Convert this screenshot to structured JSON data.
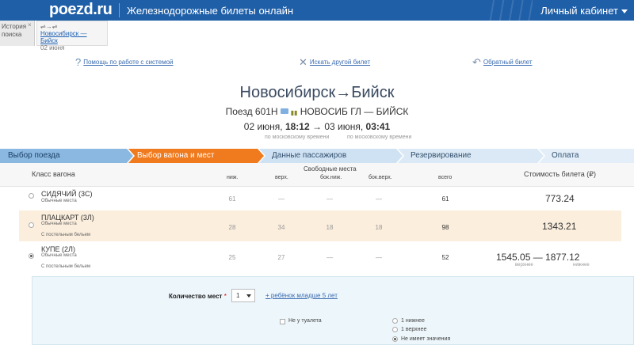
{
  "header": {
    "logo": "poezd.ru",
    "tagline": "Железнодорожные билеты онлайн",
    "cabinet": "Личный кабинет"
  },
  "history": {
    "label_line1": "История",
    "label_line2": "поиска",
    "close": "×",
    "icons": "⇌→⇌",
    "route": "Новосибирск — Бийск",
    "date": "02 июня"
  },
  "links": {
    "help": "Помощь по работе с системой",
    "other": "Искать другой билет",
    "return": "Обратный билет"
  },
  "route": {
    "title": "Новосибирск→Бийск",
    "train": "Поезд 601Н",
    "stations": "НОВОСИБ ГЛ — БИЙСК",
    "dep_date": "02 июня,",
    "dep_time": "18:12",
    "arrow": "→",
    "arr_date": "03 июня,",
    "arr_time": "03:41",
    "msk1": "по московскому времени",
    "msk2": "по московскому времени"
  },
  "steps": [
    {
      "label": "Выбор поезда",
      "state": "done"
    },
    {
      "label": "Выбор вагона и мест",
      "state": "active"
    },
    {
      "label": "Данные пассажиров",
      "state": "next"
    },
    {
      "label": "Резервирование",
      "state": "next"
    },
    {
      "label": "Оплата",
      "state": "next"
    }
  ],
  "colors": {
    "brand": "#1f5fa8",
    "step_done": "#8ab8e0",
    "step_active": "#f07a1e",
    "step_next": "#cfe2f3",
    "row_highlight": "#fbeedd"
  },
  "table": {
    "col_class": "Класс вагона",
    "col_free": "Свободные места",
    "col_low": "ниж.",
    "col_up": "верх.",
    "col_sidelow": "бок.ниж.",
    "col_sideup": "бок.верх.",
    "col_total": "всего",
    "col_price": "Стоимость билета (₽)",
    "rows": [
      {
        "name": "СИДЯЧИЙ (3С)",
        "sub": "Обычные места",
        "extra": "",
        "low": "61",
        "up": "—",
        "sidelow": "—",
        "sideup": "—",
        "total": "61",
        "price": "773.24",
        "cap1": "",
        "cap2": "",
        "selected": false
      },
      {
        "name": "ПЛАЦКАРТ (3Л)",
        "sub": "Обычные места",
        "extra": "С постельным бельем",
        "low": "28",
        "up": "34",
        "sidelow": "18",
        "sideup": "18",
        "total": "98",
        "price": "1343.21",
        "cap1": "",
        "cap2": "",
        "selected": false
      },
      {
        "name": "КУПЕ (2Л)",
        "sub": "Обычные места",
        "extra": "С постельным бельем",
        "low": "25",
        "up": "27",
        "sidelow": "—",
        "sideup": "—",
        "total": "52",
        "price": "1545.05 — 1877.12",
        "cap1": "верхнее",
        "cap2": "нижнее",
        "selected": true
      }
    ]
  },
  "panel": {
    "qty_label": "Количество мест",
    "required": "*",
    "qty_value": "1",
    "child": "+ ребёнок младше 5 лет",
    "not_toilet": "Не у туалета",
    "opt1": "1 нижнее",
    "opt2": "1 верхнее",
    "opt3": "Не имеет значения"
  }
}
